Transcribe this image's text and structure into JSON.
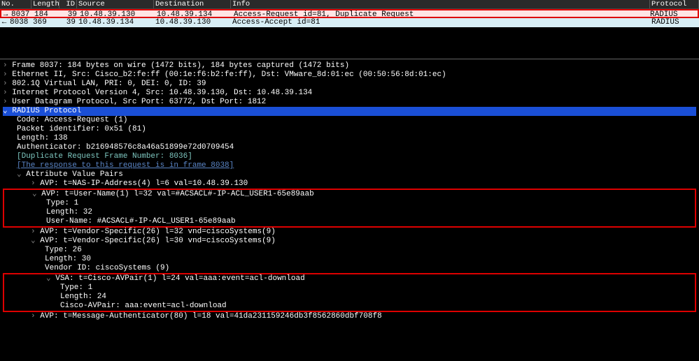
{
  "columns": {
    "no": "No.",
    "length": "Length",
    "id": "ID",
    "source": "Source",
    "destination": "Destination",
    "info": "Info",
    "protocol": "Protocol"
  },
  "packets": [
    {
      "arrow": "→",
      "no": "8037",
      "length": "184",
      "id": "39",
      "source": "10.48.39.130",
      "destination": "10.48.39.134",
      "info": "Access-Request id=81, Duplicate Request",
      "protocol": "RADIUS",
      "selected": true
    },
    {
      "arrow": "←",
      "no": "8038",
      "length": "369",
      "id": "39",
      "source": "10.48.39.134",
      "destination": "10.48.39.130",
      "info": "Access-Accept id=81",
      "protocol": "RADIUS",
      "selected": false
    }
  ],
  "details": {
    "frame": "Frame 8037: 184 bytes on wire (1472 bits), 184 bytes captured (1472 bits)",
    "eth": "Ethernet II, Src: Cisco_b2:fe:ff (00:1e:f6:b2:fe:ff), Dst: VMware_8d:01:ec (00:50:56:8d:01:ec)",
    "vlan": "802.1Q Virtual LAN, PRI: 0, DEI: 0, ID: 39",
    "ip": "Internet Protocol Version 4, Src: 10.48.39.130, Dst: 10.48.39.134",
    "udp": "User Datagram Protocol, Src Port: 63772, Dst Port: 1812",
    "radius": "RADIUS Protocol",
    "code": "Code: Access-Request (1)",
    "pktid": "Packet identifier: 0x51 (81)",
    "length": "Length: 138",
    "auth": "Authenticator: b216948576c8a46a51899e72d0709454",
    "dup": "[Duplicate Request Frame Number: 8036]",
    "resp": "[The response to this request is in frame 8038]",
    "avpHeader": "Attribute Value Pairs",
    "avp_nas": "AVP: t=NAS-IP-Address(4) l=6 val=10.48.39.130",
    "avp_user_hdr": "AVP: t=User-Name(1) l=32 val=#ACSACL#-IP-ACL_USER1-65e89aab",
    "avp_user_type": "Type: 1",
    "avp_user_len": "Length: 32",
    "avp_user_val": "User-Name: #ACSACL#-IP-ACL_USER1-65e89aab",
    "avp_vs1": "AVP: t=Vendor-Specific(26) l=32 vnd=ciscoSystems(9)",
    "avp_vs2_hdr": "AVP: t=Vendor-Specific(26) l=30 vnd=ciscoSystems(9)",
    "avp_vs2_type": "Type: 26",
    "avp_vs2_len": "Length: 30",
    "avp_vs2_vid": "Vendor ID: ciscoSystems (9)",
    "vsa_hdr": "VSA: t=Cisco-AVPair(1) l=24 val=aaa:event=acl-download",
    "vsa_type": "Type: 1",
    "vsa_len": "Length: 24",
    "vsa_val": "Cisco-AVPair: aaa:event=acl-download",
    "avp_msgauth": "AVP: t=Message-Authenticator(80) l=18 val=41da231159246db3f8562860dbf708f8"
  }
}
